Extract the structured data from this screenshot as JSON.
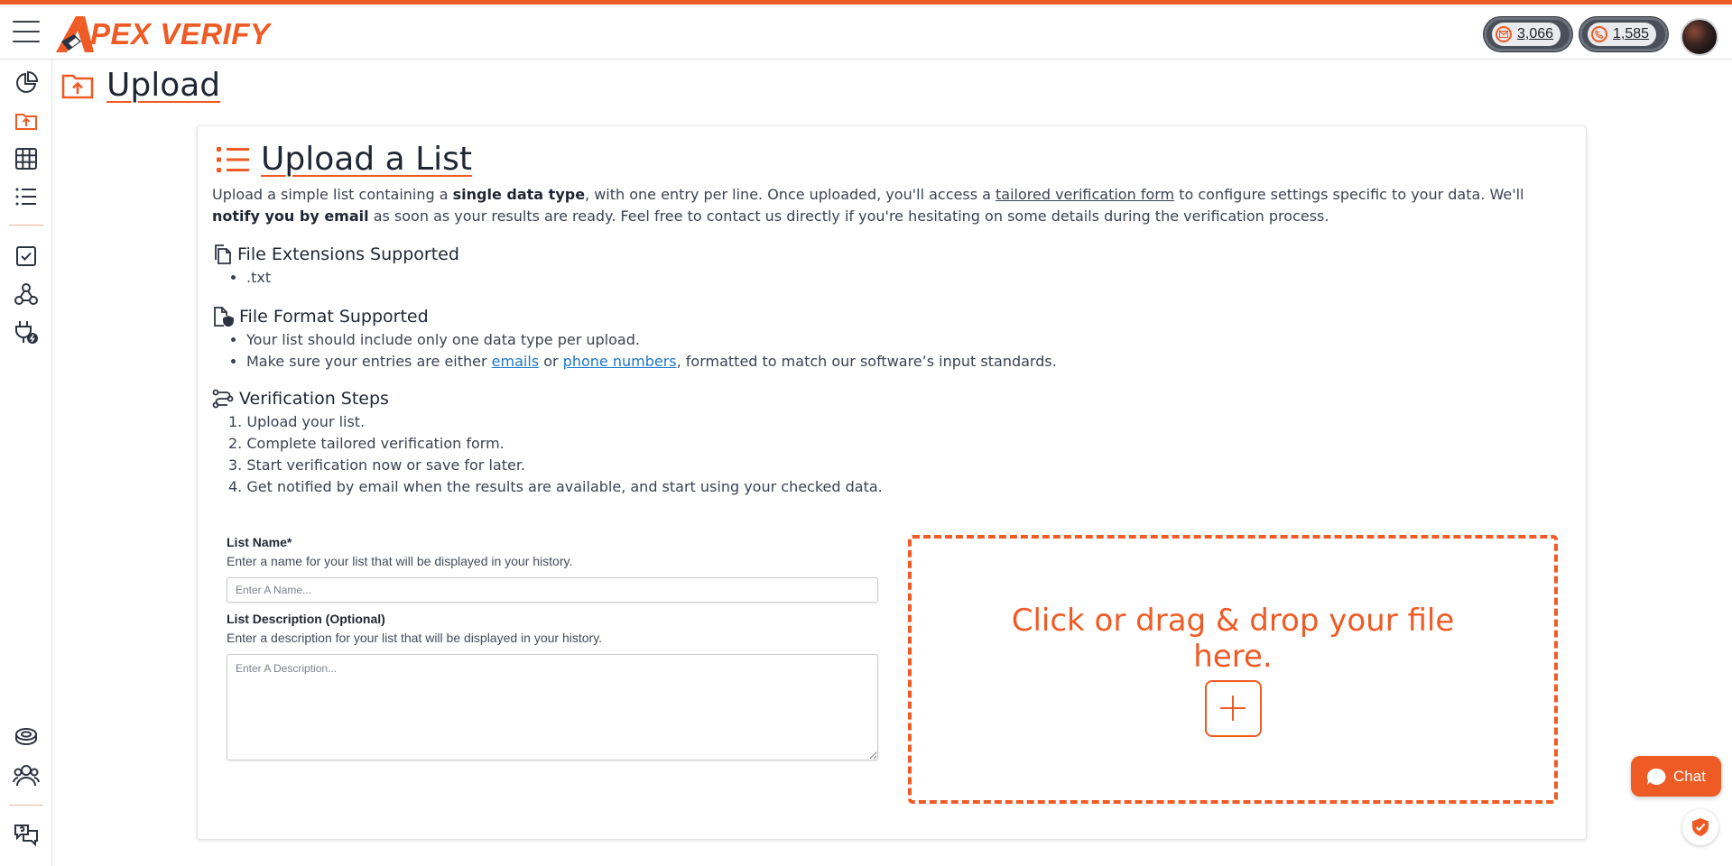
{
  "brand": {
    "logo_text": "PEX VERIFY",
    "accent": "#ef5b25"
  },
  "header": {
    "credits": [
      {
        "name": "email-credits",
        "value": "3,066"
      },
      {
        "name": "phone-credits",
        "value": "1,585"
      }
    ]
  },
  "page": {
    "title": "Upload"
  },
  "card": {
    "title": "Upload a List",
    "intro": {
      "p1": "Upload a simple list containing a ",
      "b1": "single data type",
      "p2": ", with one entry per line. Once uploaded, you'll access a ",
      "u1": "tailored verification form",
      "p3": " to configure settings specific to your data. We'll ",
      "b2": "notify you by email",
      "p4": " as soon as your results are ready. Feel free to contact us directly if you're hesitating on some details during the verification process."
    },
    "extensions": {
      "title": "File Extensions Supported",
      "items": [
        ".txt"
      ]
    },
    "format": {
      "title": "File Format Supported",
      "item1": "Your list should include only one data type per upload.",
      "item2_a": "Make sure your entries are either ",
      "item2_link1": "emails",
      "item2_b": " or ",
      "item2_link2": "phone numbers",
      "item2_c": ", formatted to match our software’s input standards."
    },
    "steps": {
      "title": "Verification Steps",
      "items": [
        "1. Upload your list.",
        "2. Complete tailored verification form.",
        "3. Start verification now or save for later.",
        "4. Get notified by email when the results are available, and start using your checked data."
      ]
    },
    "form": {
      "name_label": "List Name*",
      "name_help": "Enter a name for your list that will be displayed in your history.",
      "name_placeholder": "Enter A Name...",
      "desc_label": "List Description (Optional)",
      "desc_help": "Enter a description for your list that will be displayed in your history.",
      "desc_placeholder": "Enter A Description..."
    },
    "dropzone": {
      "text": "Click or drag & drop your file here."
    }
  },
  "widgets": {
    "chat_label": "Chat"
  }
}
